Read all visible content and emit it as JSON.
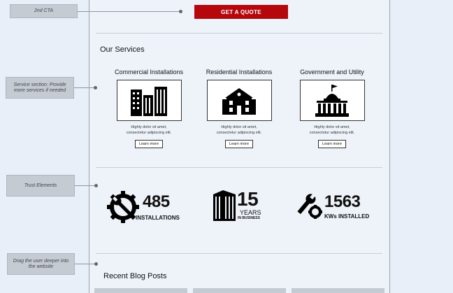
{
  "annotations": [
    {
      "id": "cta",
      "text": "2nd CTA"
    },
    {
      "id": "services",
      "text": "Service section: Provide more services if needed"
    },
    {
      "id": "trust",
      "text": "Trust Elements"
    },
    {
      "id": "blog",
      "text": "Drag the user deeper into the website"
    }
  ],
  "cta": {
    "label": "GET A QUOTE",
    "color": "#b5080d"
  },
  "services": {
    "title": "Our Services",
    "items": [
      {
        "title": "Commercial Installations",
        "desc1": "Highly dolor sit amet,",
        "desc2": "consectetur adipiscing elit.",
        "button": "Learn more",
        "icon": "office-buildings-icon"
      },
      {
        "title": "Residential Installations",
        "desc1": "Highly dolor sit amet,",
        "desc2": "consectetur adipiscing elit.",
        "button": "Learn more",
        "icon": "house-icon"
      },
      {
        "title": "Government and Utility",
        "desc1": "Highly dolor sit amet,",
        "desc2": "consectetur adipiscing elit.",
        "button": "Learn more",
        "icon": "government-building-icon"
      }
    ]
  },
  "trust": [
    {
      "number": "485",
      "label": "INSTALLATIONS",
      "sub": "",
      "icon": "gear-wrench-icon"
    },
    {
      "number": "15",
      "label": "YEARS",
      "sub": "IN BUSINESS",
      "icon": "skyscraper-icon"
    },
    {
      "number": "1563",
      "label": "KWs INSTALLED",
      "sub": "",
      "icon": "wrench-gear-icon"
    }
  ],
  "blog": {
    "title": "Recent Blog Posts"
  }
}
